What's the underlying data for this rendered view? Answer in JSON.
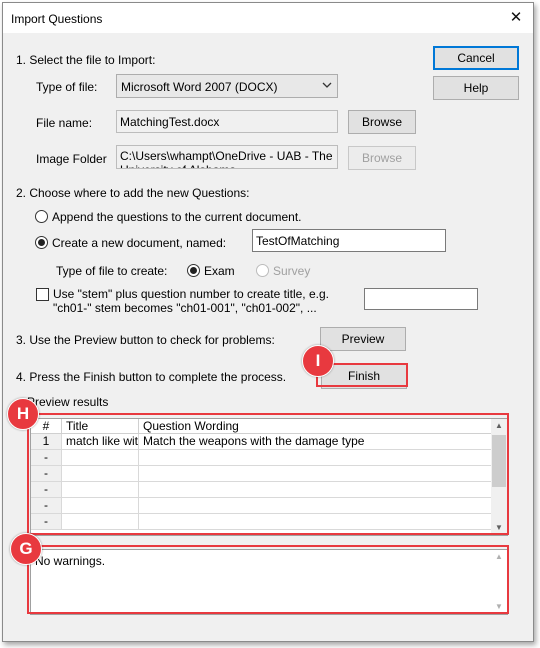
{
  "window": {
    "title": "Import Questions"
  },
  "buttons": {
    "cancel": "Cancel",
    "help": "Help",
    "browse_file": "Browse",
    "browse_image": "Browse",
    "preview": "Preview",
    "finish": "Finish"
  },
  "step1": {
    "heading": "1.  Select the file to Import:",
    "type_label": "Type of file:",
    "type_value": "Microsoft Word 2007 (DOCX)",
    "file_label": "File name:",
    "file_value": "MatchingTest.docx",
    "image_label": "Image Folder",
    "image_value": "C:\\Users\\whampt\\OneDrive - UAB - The University of Alabama"
  },
  "step2": {
    "heading": "2.  Choose where to add the new Questions:",
    "append_label": "Append the questions to the current document.",
    "create_label": "Create a new document, named:",
    "doc_name": "TestOfMatching",
    "type_create_label": "Type of file to create:",
    "exam_label": "Exam",
    "survey_label": "Survey",
    "stem_line1": "Use \"stem\" plus question number to create title,  e.g.",
    "stem_line2": "\"ch01-\" stem becomes \"ch01-001\",  \"ch01-002\",  ...",
    "stem_value": ""
  },
  "step3": {
    "text": "3.  Use the Preview button to check for problems:"
  },
  "step4": {
    "text": "4.  Press the Finish button to complete the process."
  },
  "preview": {
    "label": "Preview results",
    "columns": [
      "#",
      "Title",
      "Question Wording"
    ],
    "rows": [
      {
        "num": "1",
        "title": "match like wit",
        "wording": "Match the weapons with the damage type"
      },
      {
        "num": "-",
        "title": "",
        "wording": ""
      },
      {
        "num": "-",
        "title": "",
        "wording": ""
      },
      {
        "num": "-",
        "title": "",
        "wording": ""
      },
      {
        "num": "-",
        "title": "",
        "wording": ""
      },
      {
        "num": "-",
        "title": "",
        "wording": ""
      }
    ],
    "warnings": "No warnings."
  },
  "callouts": {
    "i": "I",
    "h": "H",
    "g": "G"
  },
  "colors": {
    "callout": "#e8393f",
    "default_button_border": "#0078d7"
  }
}
